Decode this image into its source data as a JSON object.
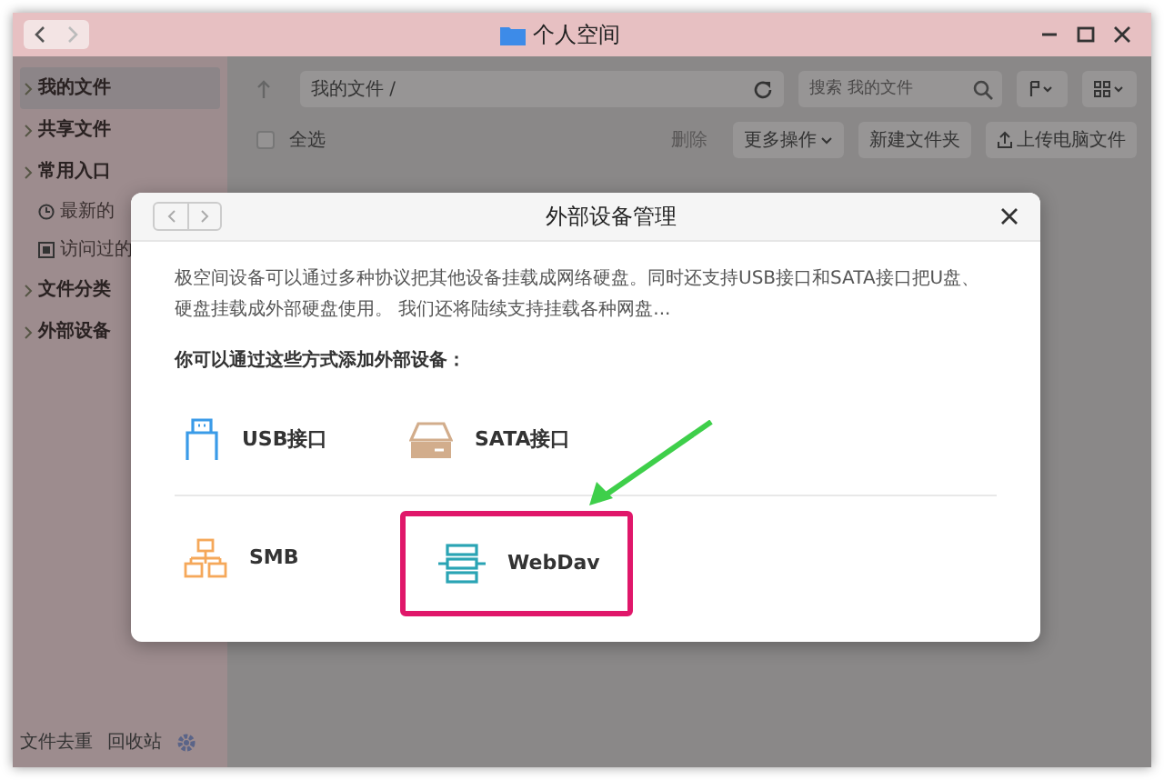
{
  "window": {
    "title": "个人空间"
  },
  "sidebar": {
    "items": [
      {
        "label": "我的文件",
        "selected": true
      },
      {
        "label": "共享文件",
        "selected": false
      },
      {
        "label": "常用入口",
        "selected": false,
        "children": [
          {
            "label": "最新的"
          },
          {
            "label": "访问过的"
          }
        ]
      },
      {
        "label": "文件分类",
        "selected": false
      },
      {
        "label": "外部设备",
        "selected": false
      }
    ],
    "footer": [
      "文件去重",
      "回收站"
    ]
  },
  "toolbar": {
    "path": "我的文件 /",
    "search_placeholder": "搜索 我的文件"
  },
  "actions": {
    "select_all": "全选",
    "select_all_checked": false,
    "buttons": [
      {
        "kind": "plain",
        "label": "删除",
        "disabled": true
      },
      {
        "kind": "dropdown",
        "label": "更多操作",
        "disabled": false
      },
      {
        "kind": "plain",
        "label": "新建文件夹",
        "disabled": false
      },
      {
        "kind": "upload",
        "label": "上传电脑文件",
        "disabled": false
      }
    ]
  },
  "dialog": {
    "title": "外部设备管理",
    "description": "极空间设备可以通过多种协议把其他设备挂载成网络硬盘。同时还支持USB接口和SATA接口把U盘、硬盘挂载成外部硬盘使用。 我们还将陆续支持挂载各种网盘...",
    "prompt": "你可以通过这些方式添加外部设备：",
    "device_rows": [
      [
        {
          "kind": "usb",
          "label": "USB接口",
          "highlighted": false
        },
        {
          "kind": "sata",
          "label": "SATA接口",
          "highlighted": false
        }
      ],
      [
        {
          "kind": "smb",
          "label": "SMB",
          "highlighted": false
        },
        {
          "kind": "webdav",
          "label": "WebDav",
          "highlighted": true
        }
      ]
    ]
  }
}
